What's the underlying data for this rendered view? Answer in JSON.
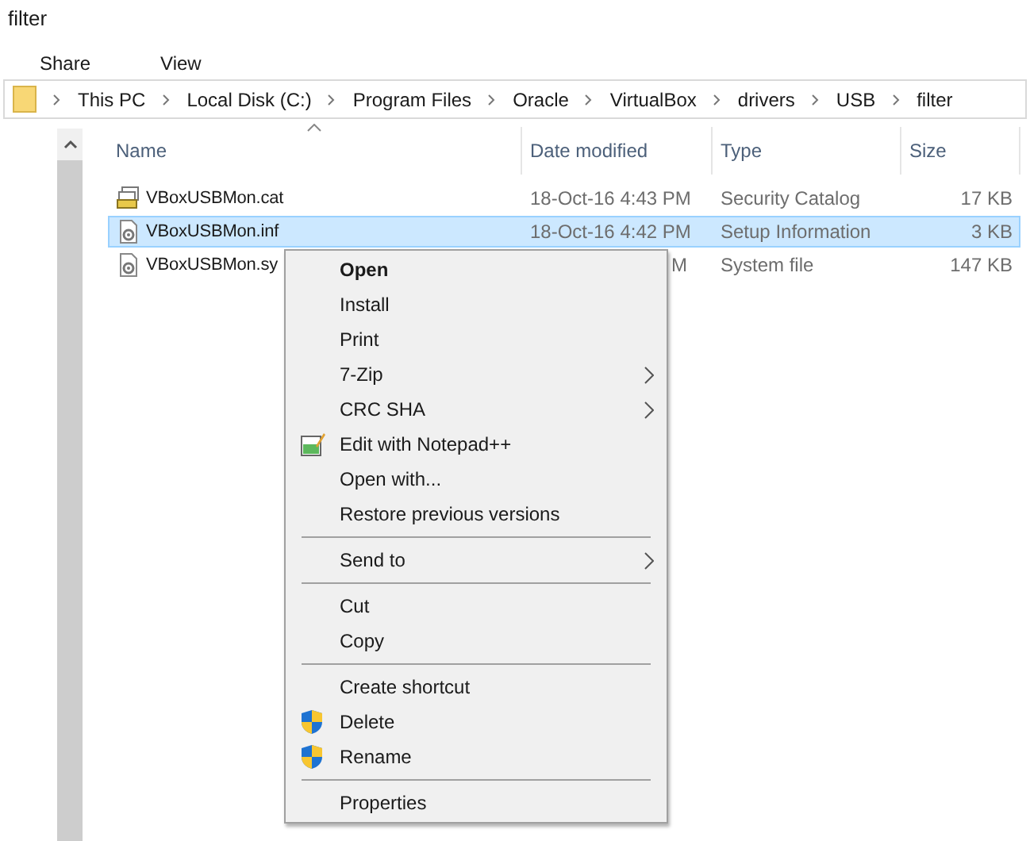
{
  "window": {
    "title": "filter"
  },
  "ribbon_tabs": [
    {
      "label": "Share",
      "selected": false
    },
    {
      "label": "View",
      "selected": false
    }
  ],
  "breadcrumb": [
    "This PC",
    "Local Disk (C:)",
    "Program Files",
    "Oracle",
    "VirtualBox",
    "drivers",
    "USB",
    "filter"
  ],
  "columns": [
    {
      "label": "Name",
      "sorted": true
    },
    {
      "label": "Date modified",
      "sorted": false
    },
    {
      "label": "Type",
      "sorted": false
    },
    {
      "label": "Size",
      "sorted": false
    }
  ],
  "files": [
    {
      "kind": "catalog",
      "name": "VBoxUSBMon.cat",
      "date": "18-Oct-16 4:43 PM",
      "type": "Security Catalog",
      "size": "17 KB",
      "selected": false
    },
    {
      "kind": "setup",
      "name": "VBoxUSBMon.inf",
      "date": "18-Oct-16 4:42 PM",
      "type": "Setup Information",
      "size": "3 KB",
      "selected": true
    },
    {
      "kind": "system",
      "name": "VBoxUSBMon.sy",
      "date": "M",
      "type": "System file",
      "size": "147 KB",
      "selected": false
    }
  ],
  "context_menu": {
    "sections": [
      [
        {
          "label": "Open",
          "kind": "command",
          "default": true
        },
        {
          "label": "Install",
          "kind": "command",
          "default": false
        },
        {
          "label": "Print",
          "kind": "command",
          "default": false
        },
        {
          "label": "7-Zip",
          "kind": "submenu",
          "default": false
        },
        {
          "label": "CRC SHA",
          "kind": "submenu",
          "default": false
        },
        {
          "label": "Edit with Notepad++",
          "kind": "edit",
          "default": false
        },
        {
          "label": "Open with...",
          "kind": "command",
          "default": false
        },
        {
          "label": "Restore previous versions",
          "kind": "command",
          "default": false
        }
      ],
      [
        {
          "label": "Send to",
          "kind": "submenu",
          "default": false
        }
      ],
      [
        {
          "label": "Cut",
          "kind": "command",
          "default": false
        },
        {
          "label": "Copy",
          "kind": "command",
          "default": false
        }
      ],
      [
        {
          "label": "Create shortcut",
          "kind": "command",
          "default": false
        },
        {
          "label": "Delete",
          "kind": "elevated",
          "default": false
        },
        {
          "label": "Rename",
          "kind": "elevated",
          "default": false
        }
      ],
      [
        {
          "label": "Properties",
          "kind": "command",
          "default": false
        }
      ]
    ]
  }
}
